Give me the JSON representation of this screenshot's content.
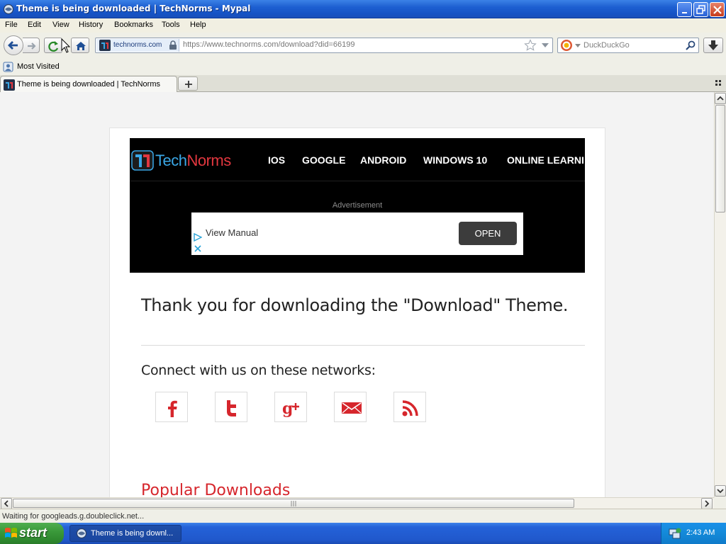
{
  "window": {
    "title": "Theme is being downloaded | TechNorms - Mypal"
  },
  "menu": {
    "items": [
      "File",
      "Edit",
      "View",
      "History",
      "Bookmarks",
      "Tools",
      "Help"
    ]
  },
  "navbar": {
    "domain": "technorms.com",
    "url": "https://www.technorms.com/download?did=66199",
    "search_placeholder": "DuckDuckGo"
  },
  "bookmarks": {
    "most_visited": "Most Visited"
  },
  "tabs": [
    {
      "title": "Theme is being downloaded | TechNorms"
    }
  ],
  "page": {
    "logo": {
      "part1": "Tech",
      "part2": "Norms"
    },
    "nav": [
      "IOS",
      "GOOGLE",
      "ANDROID",
      "WINDOWS 10",
      "ONLINE LEARNI"
    ],
    "ad": {
      "label": "Advertisement",
      "text": "View Manual",
      "button": "OPEN"
    },
    "thanks": "Thank you for downloading the \"Download\" Theme.",
    "connect": "Connect with us on these networks:",
    "social_icons": [
      "facebook-icon",
      "twitter-icon",
      "google-plus-icon",
      "email-icon",
      "rss-icon"
    ],
    "popular_heading": "Popular Downloads"
  },
  "status": {
    "text": "Waiting for googleads.g.doubleclick.net..."
  },
  "taskbar": {
    "start": "start",
    "task": "Theme is being downl...",
    "clock": "2:43 AM"
  },
  "colors": {
    "brand_blue": "#3aa7e6",
    "brand_red": "#e2373f",
    "social_red": "#d6262c",
    "xp_blue": "#245edb",
    "start_green": "#3b9a3b"
  }
}
